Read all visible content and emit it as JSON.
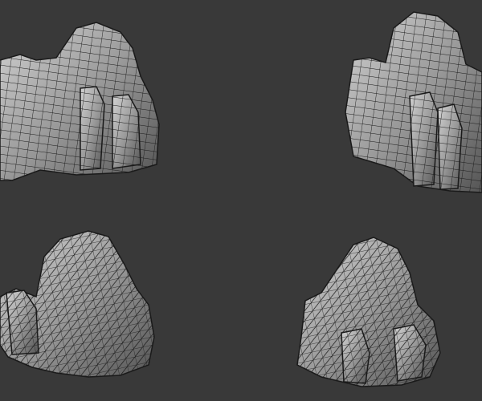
{
  "viewport": {
    "background_color": "#393939",
    "mesh_fill_light": "#c8c8c8",
    "mesh_fill_dark": "#6a6a6a",
    "wire_color": "#1a1a1a"
  },
  "models": [
    {
      "name": "rock-cluster-top-left",
      "style": "quad-wireframe"
    },
    {
      "name": "rock-cluster-top-right",
      "style": "quad-wireframe"
    },
    {
      "name": "rock-cluster-bottom-left",
      "style": "triangle-wireframe"
    },
    {
      "name": "rock-cluster-bottom-right",
      "style": "triangle-wireframe"
    }
  ]
}
